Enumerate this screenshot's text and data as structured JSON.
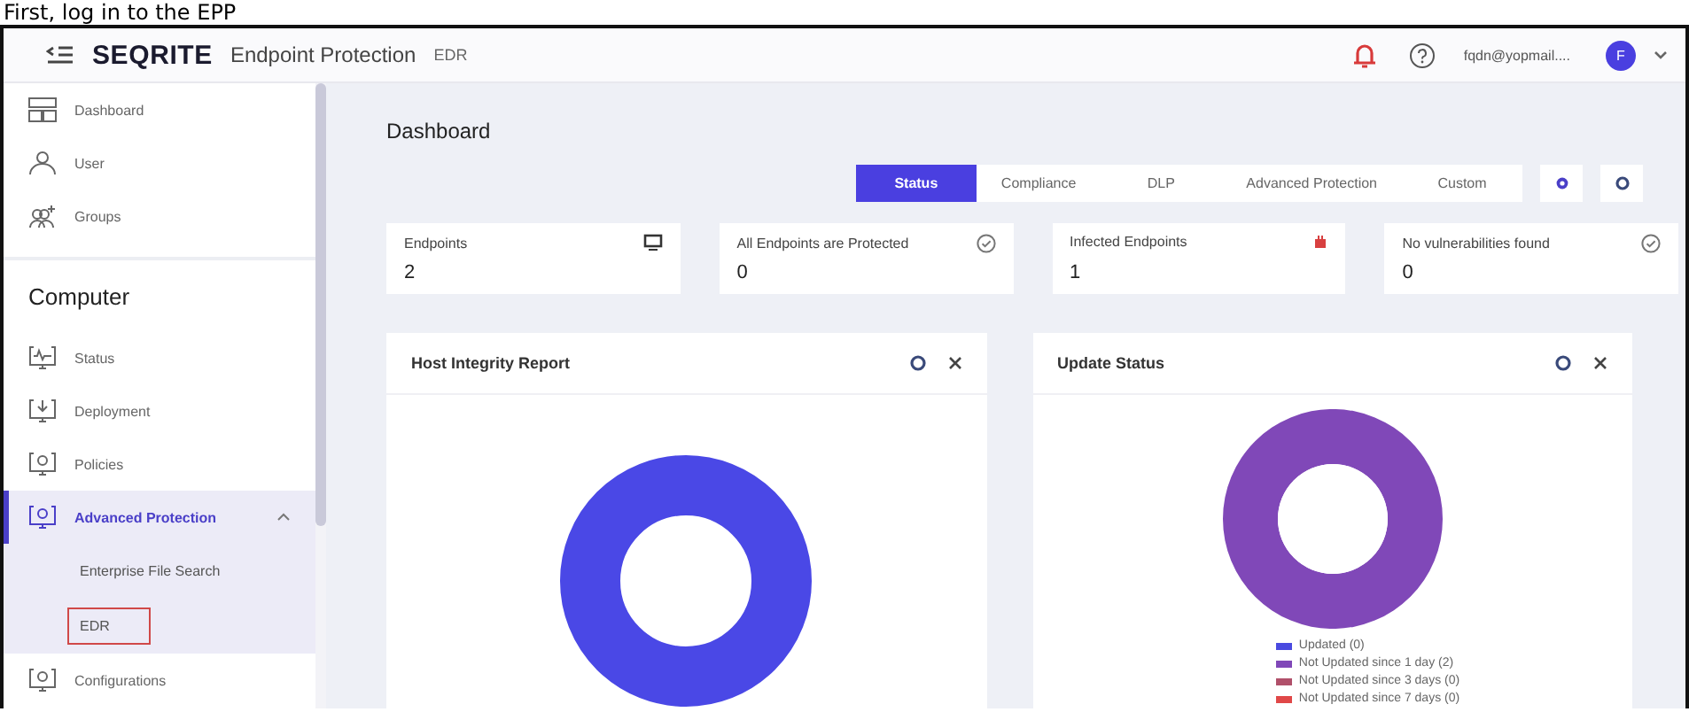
{
  "caption": "First, log in to the EPP",
  "header": {
    "logo": "SEQRITE",
    "product": "Endpoint Protection",
    "module": "EDR",
    "user_email": "fqdn@yopmail....",
    "avatar_initial": "F"
  },
  "sidebar": {
    "items": [
      {
        "label": "Dashboard",
        "selected": false
      },
      {
        "label": "User",
        "selected": false
      },
      {
        "label": "Groups",
        "selected": false
      }
    ],
    "section_title": "Computer",
    "section_items": [
      {
        "label": "Status",
        "selected": false
      },
      {
        "label": "Deployment",
        "selected": false
      },
      {
        "label": "Policies",
        "selected": false
      },
      {
        "label": "Advanced Protection",
        "selected": true,
        "expanded": true,
        "children": [
          {
            "label": "Enterprise File Search",
            "boxed": false
          },
          {
            "label": "EDR",
            "boxed": true
          }
        ]
      },
      {
        "label": "Configurations",
        "selected": false
      }
    ]
  },
  "main": {
    "title": "Dashboard",
    "tabs": [
      {
        "label": "Status",
        "selected": true
      },
      {
        "label": "Compliance",
        "selected": false
      },
      {
        "label": "DLP",
        "selected": false
      },
      {
        "label": "Advanced Protection",
        "selected": false
      },
      {
        "label": "Custom",
        "selected": false
      }
    ],
    "stats": [
      {
        "label": "Endpoints",
        "value": "2"
      },
      {
        "label": "All Endpoints are Protected",
        "value": "0"
      },
      {
        "label": "Infected Endpoints",
        "value": "1"
      },
      {
        "label": "No vulnerabilities found",
        "value": "0"
      }
    ],
    "host_integrity": {
      "title": "Host Integrity Report"
    },
    "update_status": {
      "title": "Update Status",
      "chart_data": {
        "type": "donut",
        "categories": [
          "Updated (0)",
          "Not Updated since 1 day (2)",
          "Not Updated since 3 days (0)",
          "Not Updated since 7 days (0)"
        ],
        "values": [
          0,
          2,
          0,
          0
        ],
        "colors": [
          "#4a4ae0",
          "#8048b8",
          "#b0506a",
          "#e04848"
        ]
      }
    }
  }
}
